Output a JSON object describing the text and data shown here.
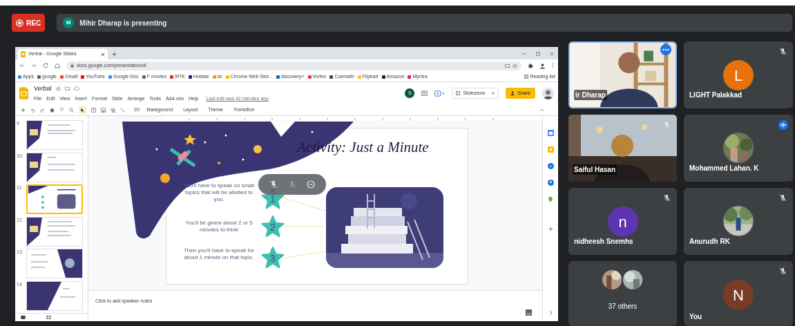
{
  "meeting": {
    "recording_label": "REC",
    "presenter_initial": "M",
    "presenter_banner": "Mihir Dharap is presenting"
  },
  "browser": {
    "tab_title": "Verbal - Google Slides",
    "url": "docs.google.com/presentation/d/",
    "bookmarks": [
      "Apps",
      "google",
      "Gmail",
      "YouTube",
      "Google Doc",
      "F movies",
      "IIITK",
      "Hotstar",
      "ss",
      "Chrome Web Stor...",
      "discovery+",
      "Vortex",
      "Cuemath",
      "Flipkart",
      "Amazon",
      "Myntra"
    ],
    "reading_list": "Reading list"
  },
  "slides": {
    "doc_title": "Verbal",
    "menu": [
      "File",
      "Edit",
      "View",
      "Insert",
      "Format",
      "Slide",
      "Arrange",
      "Tools",
      "Add-ons",
      "Help"
    ],
    "last_edit": "Last edit was 42 minutes ago",
    "account_initial": "S",
    "slideshow_label": "Slideshow",
    "share_label": "Share",
    "toolbar_zoom": "20",
    "toolbar_actions": [
      "Background",
      "Layout",
      "Theme",
      "Transition"
    ],
    "filmstrip": [
      {
        "number": "9",
        "selected": false
      },
      {
        "number": "10",
        "selected": false
      },
      {
        "number": "11",
        "selected": true
      },
      {
        "number": "12",
        "selected": false
      },
      {
        "number": "13",
        "selected": false
      },
      {
        "number": "14",
        "selected": false
      }
    ],
    "title": "Activity: Just a Minute",
    "steps": [
      {
        "number": "1",
        "text": "You'll have to speak on small topics that will be allotted to you."
      },
      {
        "number": "2",
        "text": "You'll be givew about 2 or 5 minutes to think"
      },
      {
        "number": "3",
        "text": "Then you'll have to speak for about 1 minute on that topic."
      }
    ],
    "speaker_notes_placeholder": "Click to add speaker notes"
  },
  "participants": [
    {
      "kind": "video",
      "name": "ir Dharap",
      "muted": false,
      "speaking": false,
      "hovered": true
    },
    {
      "kind": "letter",
      "name": "LIGHT Palakkad",
      "initial": "L",
      "color": "#e8710a",
      "muted": true,
      "speaking": false,
      "hovered": false
    },
    {
      "kind": "video",
      "name": "Saiful Hasan",
      "muted": true,
      "speaking": false,
      "hovered": false
    },
    {
      "name": "Mohammed Lahan. K",
      "muted": false,
      "speaking": true,
      "hovered": false
    },
    {
      "kind": "letter",
      "name": "nidheesh Snemhs",
      "initial": "n",
      "color": "#5e35b1",
      "muted": true,
      "speaking": false,
      "hovered": false
    },
    {
      "name": "Anurudh RK",
      "muted": true,
      "speaking": false,
      "hovered": false
    },
    {
      "kind": "group",
      "name": "37 others",
      "muted": false,
      "speaking": false,
      "hovered": false
    },
    {
      "kind": "letter",
      "name": "You",
      "initial": "N",
      "color": "#7a3b26",
      "muted": true,
      "speaking": false,
      "hovered": false
    }
  ]
}
